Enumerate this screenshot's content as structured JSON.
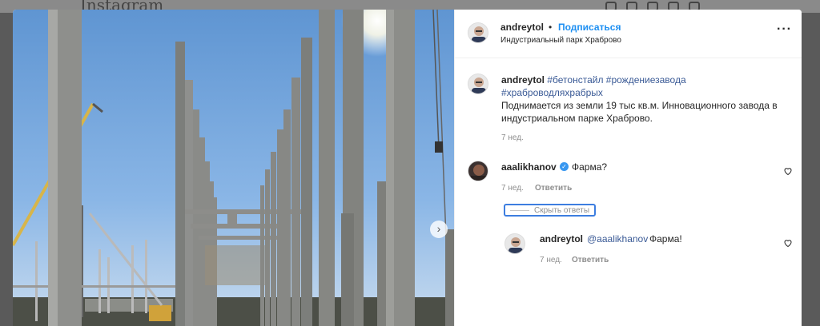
{
  "background": {
    "logo_text": "Instagram"
  },
  "header": {
    "username": "andreytol",
    "separator": "•",
    "follow_label": "Подписаться",
    "location": "Индустриальный парк Храброво",
    "more_icon": "more-icon"
  },
  "caption": {
    "username": "andreytol",
    "hashtags_line1": "#бетонстайл #рождениезавода",
    "hashtags_line2": "#храброводляхрабрых",
    "text": "Поднимается из земли 19 тыс кв.м. Инновационного завода в индустриальном парке Храброво.",
    "time": "7 нед."
  },
  "comments": [
    {
      "username": "aaalikhanov",
      "verified": true,
      "text": "Фарма?",
      "time": "7 нед.",
      "reply_label": "Ответить",
      "hide_replies_label": "Скрыть ответы",
      "replies": [
        {
          "username": "andreytol",
          "mention": "@aaalikhanov",
          "text": "Фарма!",
          "time": "7 нед.",
          "reply_label": "Ответить"
        }
      ]
    }
  ],
  "carousel": {
    "next_icon": "chevron-right-icon"
  },
  "colors": {
    "link_blue": "#1d8ff2",
    "hashtag_blue": "#3a5a96",
    "sky": "#6b9bd4"
  }
}
